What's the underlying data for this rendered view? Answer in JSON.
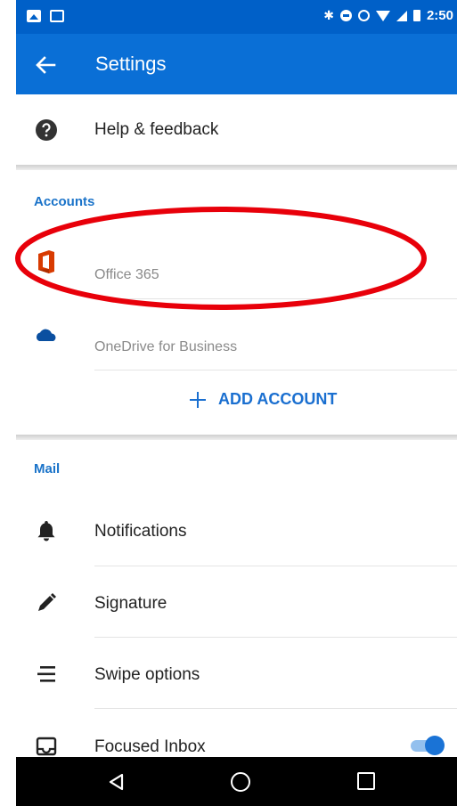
{
  "status_bar": {
    "time": "2:50"
  },
  "app_bar": {
    "title": "Settings"
  },
  "help": {
    "label": "Help & feedback"
  },
  "accounts": {
    "section_label": "Accounts",
    "items": [
      {
        "label": "Office 365",
        "icon": "office-icon"
      },
      {
        "label": "OneDrive for Business",
        "icon": "onedrive-icon"
      }
    ],
    "add_label": "ADD ACCOUNT"
  },
  "mail": {
    "section_label": "Mail",
    "items": [
      {
        "label": "Notifications",
        "icon": "bell-icon"
      },
      {
        "label": "Signature",
        "icon": "pen-icon"
      },
      {
        "label": "Swipe options",
        "icon": "swipe-icon"
      },
      {
        "label": "Focused Inbox",
        "icon": "inbox-icon",
        "toggle_on": true
      }
    ]
  },
  "colors": {
    "status_bar": "#0060c8",
    "app_bar": "#0a6fd6",
    "accent": "#1a73c9",
    "annotation": "#e8000a",
    "office_logo": "#d83b01",
    "onedrive_logo": "#0a4fa0"
  }
}
